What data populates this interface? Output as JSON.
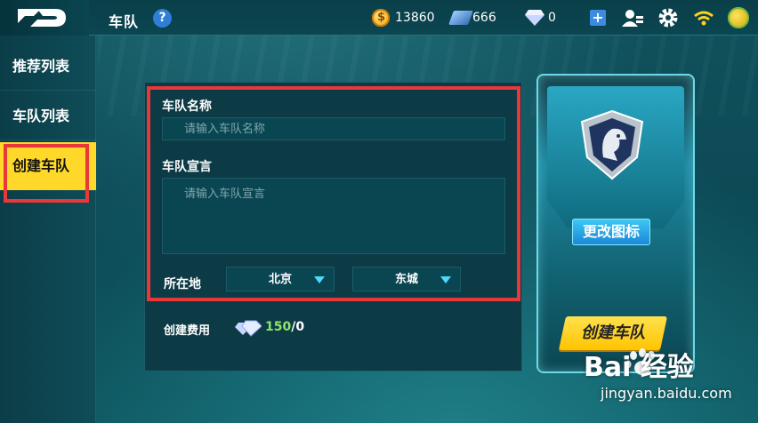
{
  "header": {
    "title": "车队",
    "help_label": "?",
    "coins": "13860",
    "tickets": "666",
    "gems": "0",
    "add_label": "+"
  },
  "sidebar": {
    "items": [
      {
        "label": "推荐列表"
      },
      {
        "label": "车队列表"
      },
      {
        "label": "创建车队",
        "active": true
      }
    ]
  },
  "form": {
    "name_label": "车队名称",
    "name_placeholder": "请输入车队名称",
    "motto_label": "车队宣言",
    "motto_placeholder": "请输入车队宣言",
    "location_label": "所在地",
    "city": "北京",
    "district": "东城",
    "fee_label": "创建费用",
    "fee_cost": "150",
    "fee_owned": "/0"
  },
  "card": {
    "change_icon_label": "更改图标",
    "create_button_label": "创建车队"
  },
  "watermark": {
    "brand": "Bai  经验",
    "url": "jingyan.baidu.com"
  },
  "colors": {
    "accent_yellow": "#ffd82a",
    "highlight_red": "#e8383a",
    "blue_button": "#1a86d6"
  }
}
